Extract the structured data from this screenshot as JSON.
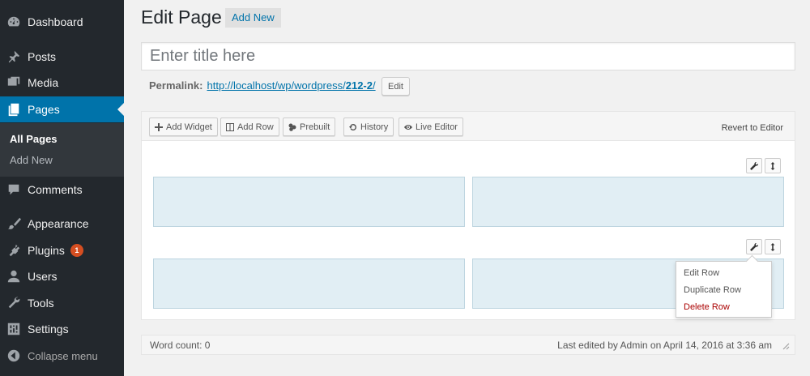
{
  "sidebar": {
    "items": [
      {
        "label": "Dashboard",
        "icon": "dashboard-icon"
      },
      {
        "label": "Posts",
        "icon": "pin-icon"
      },
      {
        "label": "Media",
        "icon": "media-icon"
      },
      {
        "label": "Pages",
        "icon": "pages-icon"
      },
      {
        "label": "Comments",
        "icon": "comment-icon"
      },
      {
        "label": "Appearance",
        "icon": "brush-icon"
      },
      {
        "label": "Plugins",
        "icon": "plugin-icon",
        "badge": "1"
      },
      {
        "label": "Users",
        "icon": "user-icon"
      },
      {
        "label": "Tools",
        "icon": "wrench-icon"
      },
      {
        "label": "Settings",
        "icon": "settings-icon"
      }
    ],
    "submenu": {
      "all_pages": "All Pages",
      "add_new": "Add New"
    },
    "collapse": "Collapse menu",
    "accent_color": "#0073aa",
    "bg_color": "#23282d",
    "badge_color": "#d54e21"
  },
  "header": {
    "title": "Edit Page",
    "add_new": "Add New"
  },
  "title_field": {
    "value": "",
    "placeholder": "Enter title here"
  },
  "permalink": {
    "label": "Permalink:",
    "url_base": "http://localhost/wp/wordpress/",
    "slug": "212-2",
    "url_end": "/",
    "edit": "Edit"
  },
  "builder": {
    "toolbar": [
      {
        "label": "Add Widget",
        "icon": "plus-icon"
      },
      {
        "label": "Add Row",
        "icon": "columns-icon"
      },
      {
        "label": "Prebuilt",
        "icon": "prebuilt-icon"
      },
      {
        "label": "History",
        "icon": "undo-icon"
      },
      {
        "label": "Live Editor",
        "icon": "eye-icon"
      }
    ],
    "revert": "Revert to Editor",
    "row_menu": [
      "Edit Row",
      "Duplicate Row",
      "Delete Row"
    ],
    "cell_color": "#e1eef4"
  },
  "footer": {
    "word_count": "Word count: 0",
    "last_edited": "Last edited by Admin on April 14, 2016 at 3:36 am"
  }
}
